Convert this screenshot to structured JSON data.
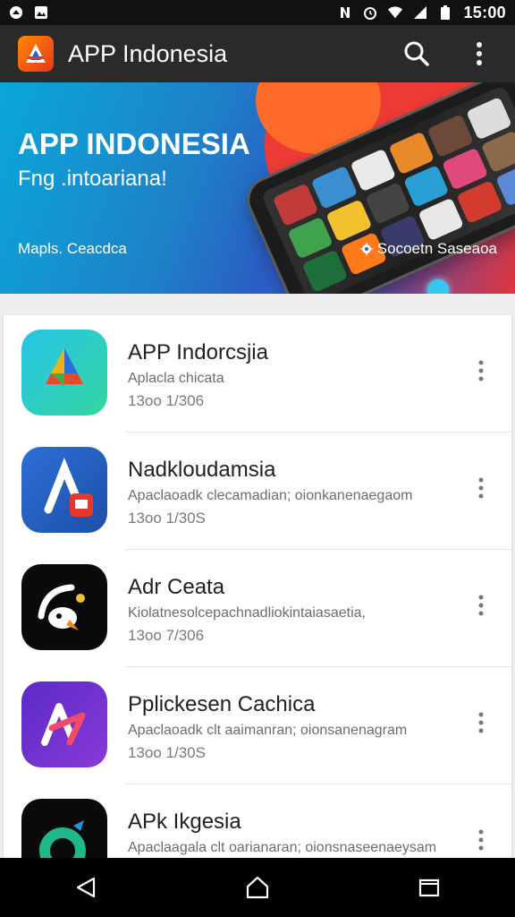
{
  "status_bar": {
    "time": "15:00",
    "icons": [
      "notification-icon",
      "photo-icon",
      "nfc-icon",
      "alarm-icon",
      "wifi-icon",
      "signal-icon",
      "battery-icon"
    ]
  },
  "app_bar": {
    "title": "APP Indonesia",
    "actions": [
      "search-icon",
      "more-vert-icon"
    ]
  },
  "banner": {
    "title": "APP INDONESIA",
    "subtitle": "Fng .intoariana!",
    "left_caption": "Mapls. Ceacdca",
    "right_caption": "Socoetn Saseaoa"
  },
  "apps": [
    {
      "title": "APP Indorcsjia",
      "description": "Aplacla chicata",
      "size": "13oo 1/306"
    },
    {
      "title": "Nadkloudamsia",
      "description": "Apaclaoadk clecamadian; oionkanenaegaom",
      "size": "13oo 1/30S"
    },
    {
      "title": "Adr Ceata",
      "description": "Kiolatnesolcepachnadliokintaiasaetia,",
      "size": "13oo 7/306"
    },
    {
      "title": "Pplickesen Cachica",
      "description": "Apaclaoadk clt aaimanran; oionsanenagram",
      "size": "13oo 1/30S"
    },
    {
      "title": "APk Ikgesia",
      "description": "Apaclaagala clt oarianaran; oionsnaseenaeysam",
      "size": ""
    }
  ],
  "nav_bar": [
    "back-icon",
    "home-icon",
    "recents-icon"
  ],
  "colors": {
    "app_bar": "#2a2a2a",
    "status_bar": "#111111",
    "banner_blue": "#1e80c8",
    "banner_red": "#ef3b35"
  }
}
